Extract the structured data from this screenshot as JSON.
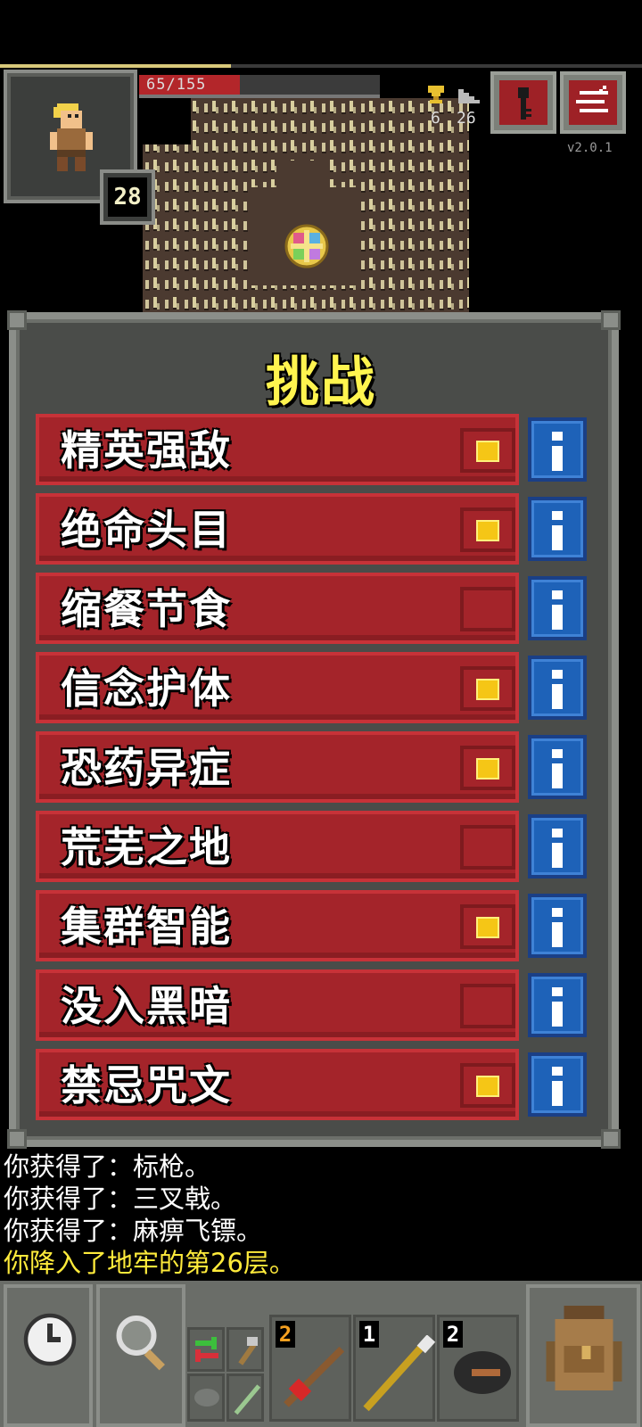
{
  "status": {
    "hp_text": "65/155",
    "hp_fraction": 0.42,
    "xp_fraction": 0.36,
    "level": "28",
    "gold": "6",
    "depth": "26",
    "version": "v2.0.1"
  },
  "dialog": {
    "title": "挑战",
    "challenges": [
      {
        "label": "精英强敌",
        "checked": true
      },
      {
        "label": "绝命头目",
        "checked": true
      },
      {
        "label": "缩餐节食",
        "checked": false
      },
      {
        "label": "信念护体",
        "checked": true
      },
      {
        "label": "恐药异症",
        "checked": true
      },
      {
        "label": "荒芜之地",
        "checked": false
      },
      {
        "label": "集群智能",
        "checked": true
      },
      {
        "label": "没入黑暗",
        "checked": false
      },
      {
        "label": "禁忌咒文",
        "checked": true
      }
    ]
  },
  "log": [
    {
      "text": "你获得了：标枪。",
      "highlight": false
    },
    {
      "text": "你获得了：三叉戟。",
      "highlight": false
    },
    {
      "text": "你获得了：麻痹飞镖。",
      "highlight": false
    },
    {
      "text": "你降入了地牢的第26层。",
      "highlight": true
    }
  ],
  "quickslots": [
    {
      "count": "2",
      "icon": "dart-icon"
    },
    {
      "count": "1",
      "icon": "javelin-icon"
    },
    {
      "count": "2",
      "icon": "bolas-icon"
    }
  ],
  "colors": {
    "row_bg": "#a4242a",
    "check_fill": "#f5c616",
    "info_bg": "#1e62b8",
    "title": "#fff44f",
    "log_highlight": "#ffeb3b"
  }
}
